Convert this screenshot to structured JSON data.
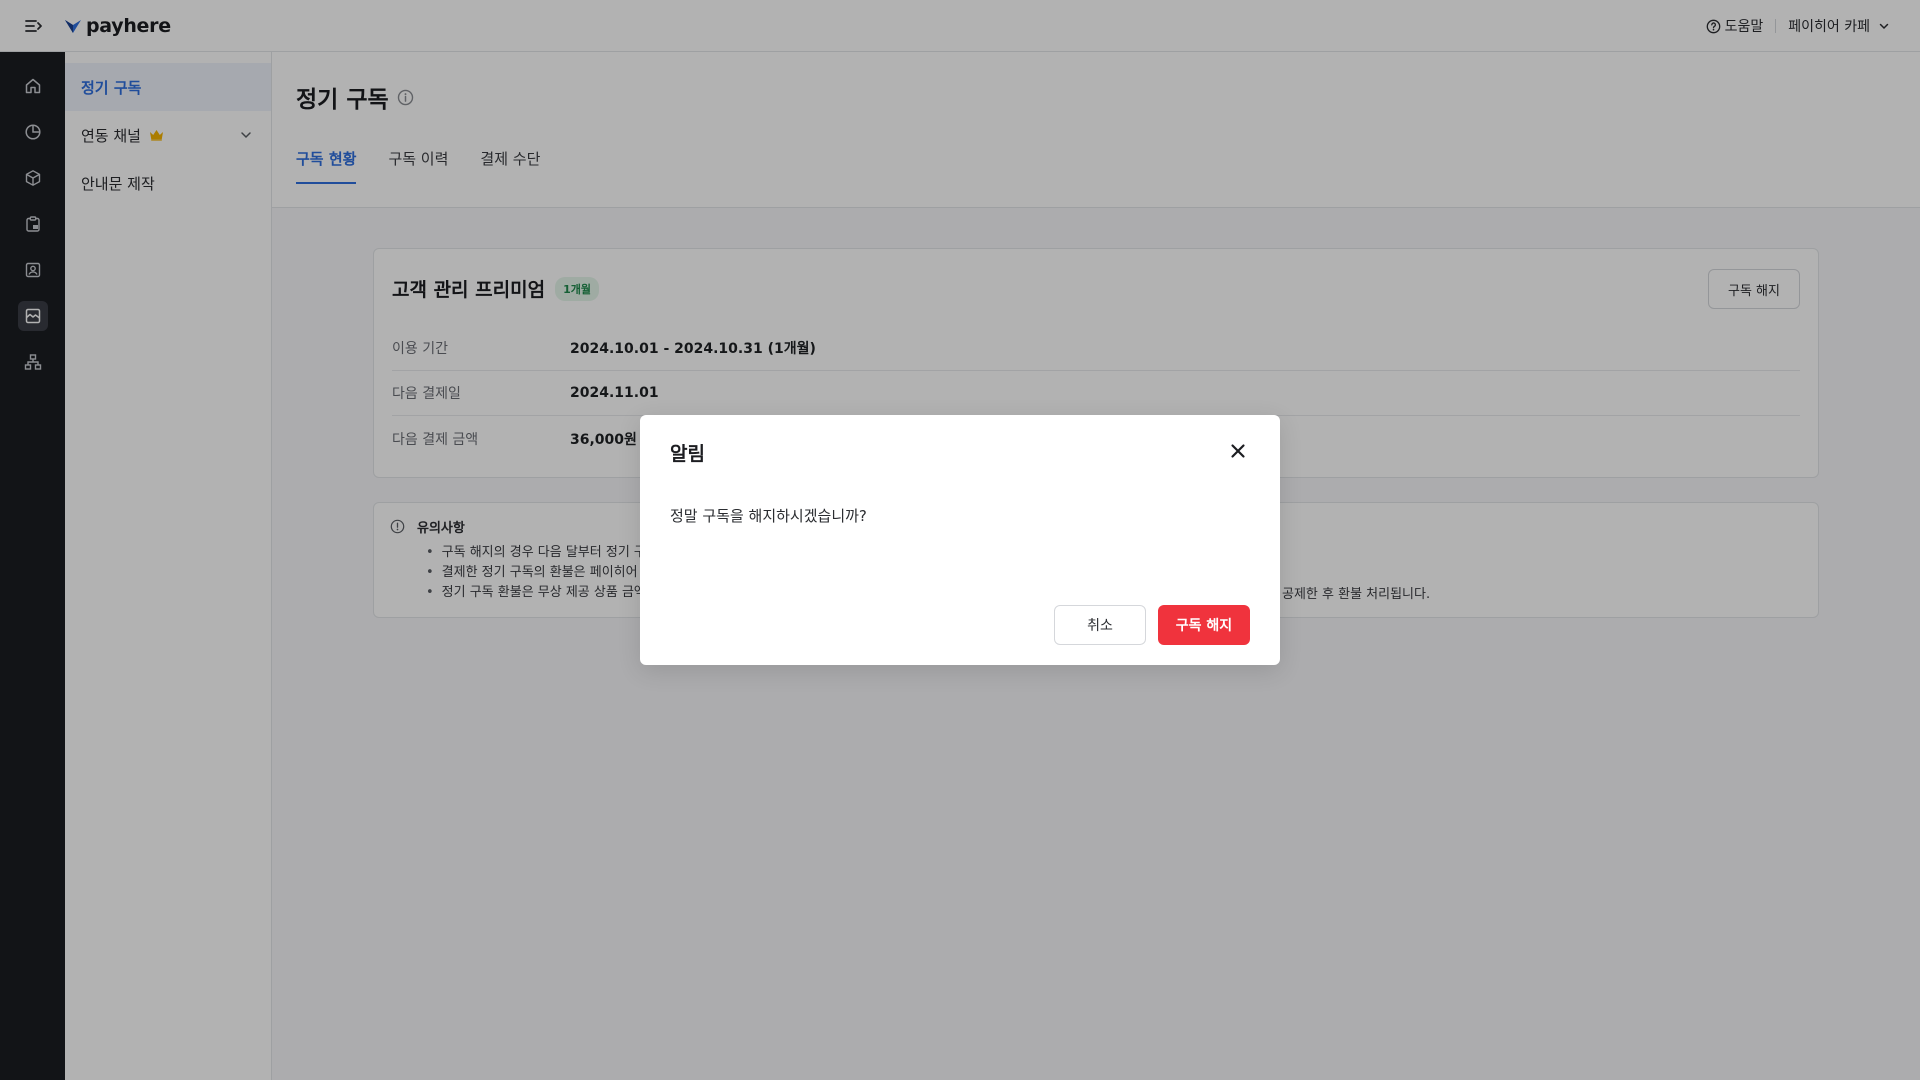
{
  "app": {
    "brand": "payhere",
    "brand_color": "#2f6fde",
    "help_label": "도움말",
    "store_name": "페이히어 카페"
  },
  "rail": {
    "items": [
      {
        "icon": "home-icon"
      },
      {
        "icon": "pie-chart-icon"
      },
      {
        "icon": "box-icon"
      },
      {
        "icon": "clipboard-icon"
      },
      {
        "icon": "contact-card-icon"
      },
      {
        "icon": "store-icon",
        "active": true
      },
      {
        "icon": "sitemap-icon"
      }
    ]
  },
  "subnav": {
    "items": [
      {
        "label": "정기 구독",
        "active": true
      },
      {
        "label": "연동 채널",
        "has_crown": true,
        "expandable": true
      },
      {
        "label": "안내문 제작"
      }
    ]
  },
  "page": {
    "title": "정기 구독",
    "tabs": [
      {
        "label": "구독 현황",
        "active": true
      },
      {
        "label": "구독 이력"
      },
      {
        "label": "결제 수단"
      }
    ]
  },
  "subscription": {
    "plan_name": "고객 관리 프리미엄",
    "plan_badge": "1개월",
    "cancel_label": "구독 해지",
    "rows": [
      {
        "label": "이용 기간",
        "value": "2024.10.01 - 2024.10.31 (1개월)"
      },
      {
        "label": "다음 결제일",
        "value": "2024.11.01"
      },
      {
        "label": "다음 결제 금액",
        "value": "36,000원"
      }
    ]
  },
  "notice": {
    "title": "유의사항",
    "items": [
      "구독 해지의 경우 다음 달부터 정기 구",
      "결제한 정기 구독의 환불은 페이히어 .",
      "정기 구독 환불은 무상 제공 상품 금액"
    ],
    "item3_tail": "공제한 후 환불 처리됩니다."
  },
  "modal": {
    "title": "알림",
    "message": "정말 구독을 해지하시겠습니까?",
    "cancel_label": "취소",
    "confirm_label": "구독 해지",
    "confirm_color": "#f0333d"
  }
}
